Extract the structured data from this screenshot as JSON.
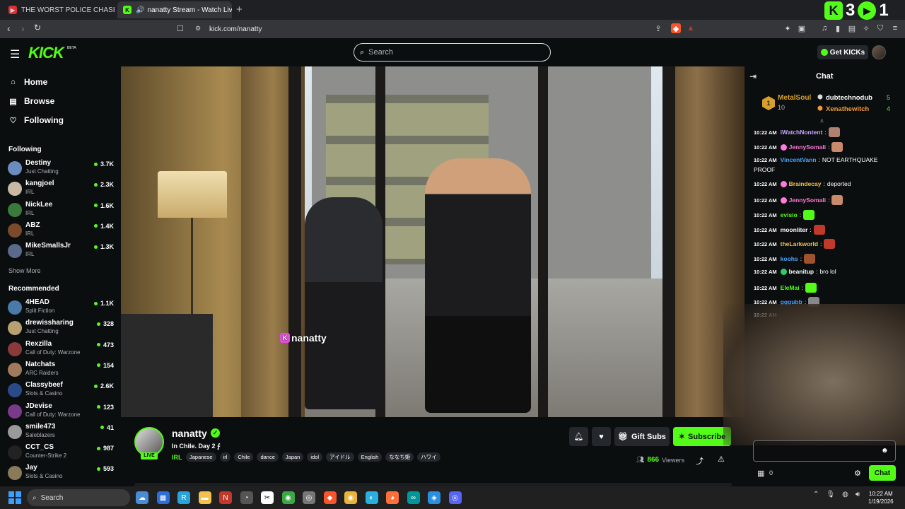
{
  "browser": {
    "tabs": [
      {
        "title": "THE WORST POLICE CHASE I'VE EVER",
        "favicon_color": "#e03030"
      },
      {
        "title": "nanatty Stream - Watch Live o",
        "favicon_color": "#53fc18",
        "active": true
      }
    ],
    "new_tab": "+",
    "url": "kick.com/nanatty",
    "overlay": {
      "count_a": "3",
      "count_b": "1"
    }
  },
  "kick": {
    "logo": "KICK",
    "logo_badge": "BETA",
    "search_placeholder": "Search",
    "get_kicks_label": "Get KICKs",
    "accent": "#53fc18"
  },
  "sidebar": {
    "nav": [
      {
        "label": "Home",
        "icon": "home-icon"
      },
      {
        "label": "Browse",
        "icon": "browse-icon"
      },
      {
        "label": "Following",
        "icon": "heart-icon"
      }
    ],
    "following_header": "Following",
    "following": [
      {
        "name": "Destiny",
        "category": "Just Chatting",
        "viewers": "3.7K",
        "color": "#6a8cbf"
      },
      {
        "name": "kangjoel",
        "category": "IRL",
        "viewers": "2.3K",
        "color": "#c9b8a4"
      },
      {
        "name": "NickLee",
        "category": "IRL",
        "viewers": "1.6K",
        "color": "#3a7a3a"
      },
      {
        "name": "ABZ",
        "category": "IRL",
        "viewers": "1.4K",
        "color": "#7a4a2a"
      },
      {
        "name": "MikeSmallsJr",
        "category": "IRL",
        "viewers": "1.3K",
        "color": "#5a6a8a"
      }
    ],
    "show_more": "Show More",
    "recommended_header": "Recommended",
    "recommended": [
      {
        "name": "4HEAD",
        "category": "Split Fiction",
        "viewers": "1.1K",
        "color": "#4a7aaa"
      },
      {
        "name": "drewissharing",
        "category": "Just Chatting",
        "viewers": "328",
        "color": "#b8a070"
      },
      {
        "name": "Rexzilla",
        "category": "Call of Duty: Warzone",
        "viewers": "473",
        "color": "#8a3a3a"
      },
      {
        "name": "Natchats",
        "category": "ARC Raiders",
        "viewers": "154",
        "color": "#a07a5a"
      },
      {
        "name": "Classybeef",
        "category": "Slots & Casino",
        "viewers": "2.6K",
        "color": "#2a4a8a"
      },
      {
        "name": "JDevise",
        "category": "Call of Duty: Warzone",
        "viewers": "123",
        "color": "#7a3a8a"
      },
      {
        "name": "smile473",
        "category": "Saleblazers",
        "viewers": "41",
        "color": "#9a9a9a"
      },
      {
        "name": "CCT_CS",
        "category": "Counter-Strike 2",
        "viewers": "987",
        "color": "#222222"
      },
      {
        "name": "Jay",
        "category": "Slots & Casino",
        "viewers": "593",
        "color": "#8a7a5a"
      }
    ]
  },
  "stream": {
    "watermark": "nanatty",
    "streamer": "nanatty",
    "live_badge": "LIVE",
    "title": "In Chile. Day 2 ⨍",
    "category": "IRL",
    "tags": [
      "Japanese",
      "irl",
      "Chile",
      "dance",
      "Japan",
      "idol",
      "アイドル",
      "English",
      "ななち姫",
      "ハワイ"
    ],
    "gift_subs_label": "Gift Subs",
    "subscribe_label": "Subscribe",
    "viewers_count": "866",
    "viewers_label": "Viewers"
  },
  "chat": {
    "title": "Chat",
    "leaderboard": [
      {
        "rank": "1",
        "name": "MetalSoul",
        "count": "10",
        "color": "#d6a02a"
      },
      {
        "name": "dubtechnodub",
        "count": "5",
        "color": "#ffffff"
      },
      {
        "name": "Xenathewitch",
        "count": "4",
        "color": "#f29a3a"
      }
    ],
    "messages": [
      {
        "time": "10:22 AM",
        "user": "iWatchNontent",
        "color": "#c9a6ff",
        "text": "",
        "emote": "#b08070"
      },
      {
        "time": "10:22 AM",
        "user": "JennySomali",
        "color": "#ff7ad9",
        "badge": "#ff7ad9",
        "text": "",
        "emote": "#c98a6a"
      },
      {
        "time": "10:22 AM",
        "user": "VincentVann",
        "color": "#4aa3ff",
        "text": "NOT EARTHQUAKE"
      },
      {
        "time": "",
        "user": "",
        "color": "#ffffff",
        "text": "PROOF"
      },
      {
        "time": "10:22 AM",
        "user": "Braindecay",
        "color": "#f2c14e",
        "badge": "#ff7ad9",
        "text": "deported"
      },
      {
        "time": "10:22 AM",
        "user": "JennySomali",
        "color": "#ff7ad9",
        "badge": "#ff7ad9",
        "text": "",
        "emote": "#c98a6a"
      },
      {
        "time": "10:22 AM",
        "user": "evisio",
        "color": "#53fc18",
        "text": "",
        "emote": "#53fc18"
      },
      {
        "time": "10:22 AM",
        "user": "moonliter",
        "color": "#ffffff",
        "text": "",
        "emote": "#c0392b"
      },
      {
        "time": "10:22 AM",
        "user": "theLarkworld",
        "color": "#f2c14e",
        "text": "",
        "emote": "#c0392b"
      },
      {
        "time": "10:22 AM",
        "user": "koohs",
        "color": "#4aa3ff",
        "text": "",
        "emote": "#a0522d"
      },
      {
        "time": "10:22 AM",
        "user": "beanitup",
        "color": "#ffffff",
        "badge": "#2ecc71",
        "text": "bro lol"
      },
      {
        "time": "10:22 AM",
        "user": "EleMai",
        "color": "#53fc18",
        "text": "",
        "emote": "#53fc18"
      },
      {
        "time": "10:22 AM",
        "user": "gggubb",
        "color": "#4aa3ff",
        "text": "",
        "emote": "#888888"
      },
      {
        "time": "10:22 AM",
        "user": "",
        "color": "#ffffff",
        "text": ""
      }
    ],
    "channel_points": "0",
    "send_label": "Chat"
  },
  "taskbar": {
    "search_label": "Search",
    "apps": [
      {
        "name": "widgets-icon",
        "color": "#4a8bd8"
      },
      {
        "name": "people-icon",
        "color": "#2d6fd8"
      },
      {
        "name": "rider-icon",
        "color": "#2aa3d8"
      },
      {
        "name": "folder-icon",
        "color": "#f2c14e"
      },
      {
        "name": "news-icon",
        "color": "#c0392b"
      },
      {
        "name": "clock-app-icon",
        "color": "#555555"
      },
      {
        "name": "capcut-icon",
        "color": "#ffffff"
      },
      {
        "name": "chrome-icon",
        "color": "#3aa845"
      },
      {
        "name": "obs-icon",
        "color": "#777777"
      },
      {
        "name": "brave-icon",
        "color": "#fb542b"
      },
      {
        "name": "chrome-alt-icon",
        "color": "#e8b53a"
      },
      {
        "name": "edge-icon",
        "color": "#2ab0e0"
      },
      {
        "name": "firefox-icon",
        "color": "#ff7139"
      },
      {
        "name": "arduino-icon",
        "color": "#00979c"
      },
      {
        "name": "vscode-icon",
        "color": "#2a8fe0"
      },
      {
        "name": "discord-icon",
        "color": "#5865f2"
      }
    ],
    "time": "10:22 AM",
    "date": "1/19/2026"
  }
}
